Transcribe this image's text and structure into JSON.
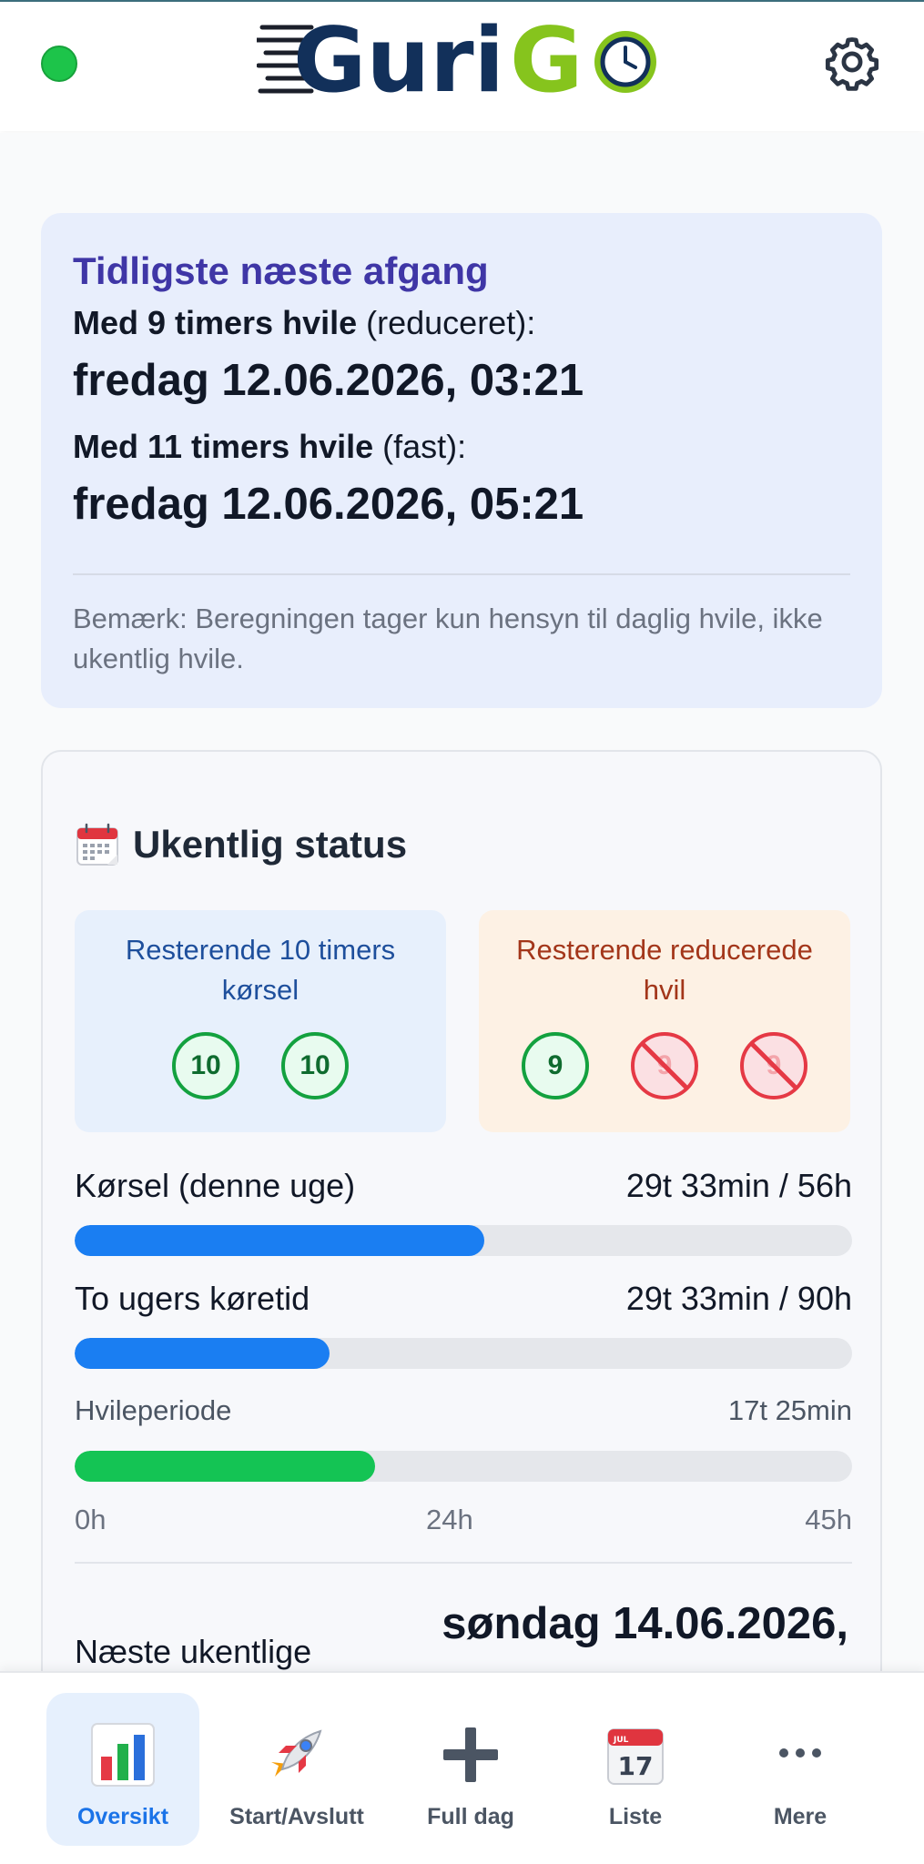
{
  "app": {
    "name_part1": "Guri",
    "name_part2": "GO",
    "brand_dark": "#12305a",
    "brand_green": "#86c41d",
    "status_color": "#1dc44a"
  },
  "header": {
    "status_icon": "status-dot",
    "settings_icon": "gear-icon"
  },
  "departure": {
    "title": "Tidligste næste afgang",
    "rest9_bold": "Med 9 timers hvile",
    "rest9_suffix": " (reduceret):",
    "rest9_date": "fredag 12.06.2026, 03:21",
    "rest11_bold": "Med 11 timers hvile",
    "rest11_suffix": " (fast):",
    "rest11_date": "fredag 12.06.2026, 05:21",
    "note": "Bemærk: Beregningen tager kun hensyn til daglig hvile, ikke ukentlig hvile."
  },
  "weekly": {
    "icon": "calendar-icon",
    "title": "Ukentlig status",
    "driving10": {
      "title": "Resterende 10 timers kørsel",
      "badges": [
        {
          "value": "10",
          "available": true
        },
        {
          "value": "10",
          "available": true
        }
      ]
    },
    "reduced_rest": {
      "title": "Resterende reducerede hvil",
      "badges": [
        {
          "value": "9",
          "available": true
        },
        {
          "value": "9",
          "available": false
        },
        {
          "value": "9",
          "available": false
        }
      ]
    },
    "bars": [
      {
        "label": "Kørsel (denne uge)",
        "value": "29t 33min / 56h",
        "fraction": 0.527
      },
      {
        "label": "To ugers køretid",
        "value": "29t 33min / 90h",
        "fraction": 0.328
      },
      {
        "label": "Hvileperiode",
        "value": "17t 25min",
        "fraction": 0.387
      }
    ],
    "scale": {
      "start": "0h",
      "mid": "24h",
      "end": "45h"
    },
    "next_label": "Næste ukentlige",
    "next_date": "søndag 14.06.2026,"
  },
  "nav": [
    {
      "label": "Oversikt",
      "icon": "bar-chart-icon",
      "active": true
    },
    {
      "label": "Start/Avslutt",
      "icon": "rocket-icon",
      "active": false
    },
    {
      "label": "Full dag",
      "icon": "plus-icon",
      "active": false
    },
    {
      "label": "Liste",
      "icon": "calendar-17-icon",
      "active": false
    },
    {
      "label": "Mere",
      "icon": "more-dots-icon",
      "active": false
    }
  ]
}
